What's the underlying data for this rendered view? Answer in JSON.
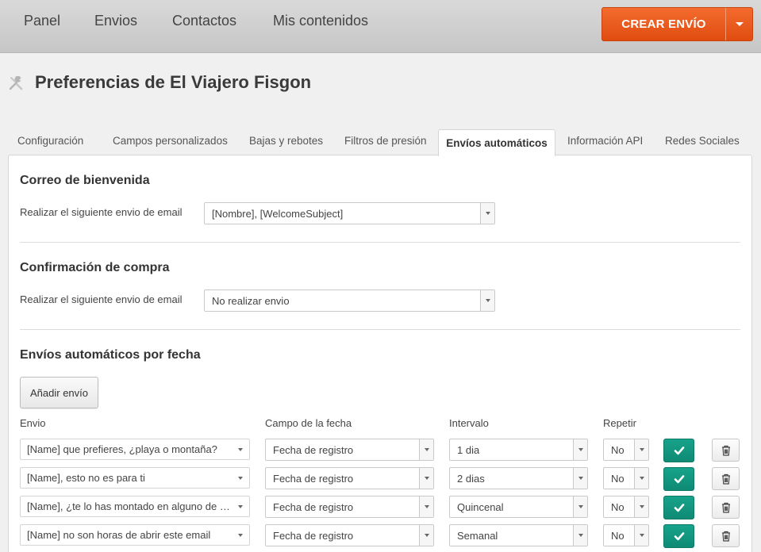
{
  "nav": {
    "items": [
      {
        "label": "Panel"
      },
      {
        "label": "Envios"
      },
      {
        "label": "Contactos"
      },
      {
        "label": "Mis contenidos"
      }
    ],
    "create_button": "CREAR ENVÍO",
    "create_dropdown_icon": "caret-down-icon"
  },
  "header": {
    "icon": "tools-icon",
    "title": "Preferencias de El Viajero Fisgon"
  },
  "tabs": [
    {
      "label": "Configuración"
    },
    {
      "label": "Campos personalizados"
    },
    {
      "label": "Bajas y rebotes"
    },
    {
      "label": "Filtros de presión"
    },
    {
      "label": "Envíos automáticos",
      "active": true
    },
    {
      "label": "Información API"
    },
    {
      "label": "Redes Sociales"
    }
  ],
  "welcome": {
    "title": "Correo de bienvenida",
    "label": "Realizar el siguiente envio de email",
    "value": "[Nombre], [WelcomeSubject]"
  },
  "purchase": {
    "title": "Confirmación de compra",
    "label": "Realizar el siguiente envio de email",
    "value": "No realizar envio"
  },
  "by_date": {
    "title": "Envíos automáticos por fecha",
    "add_button": "Añadir envío",
    "columns": {
      "envio": "Envio",
      "campo": "Campo de la fecha",
      "intervalo": "Intervalo",
      "repetir": "Repetir"
    },
    "rows": [
      {
        "envio": "[Name] que prefieres, ¿playa o montaña?",
        "campo": "Fecha de registro",
        "intervalo": "1 dia",
        "repetir": "No"
      },
      {
        "envio": "[Name], esto no es para ti",
        "campo": "Fecha de registro",
        "intervalo": "2 dias",
        "repetir": "No"
      },
      {
        "envio": "[Name], ¿te lo has montado en alguno de esto...",
        "campo": "Fecha de registro",
        "intervalo": "Quincenal",
        "repetir": "No"
      },
      {
        "envio": "[Name] no son horas de abrir este email",
        "campo": "Fecha de registro",
        "intervalo": "Semanal",
        "repetir": "No"
      }
    ],
    "row_actions": {
      "confirm_icon": "check-icon",
      "delete_icon": "trash-icon"
    }
  },
  "colors": {
    "accent_orange": "#e8561a",
    "confirm_green": "#12967f",
    "nav_bg": "#cfcfcf"
  }
}
